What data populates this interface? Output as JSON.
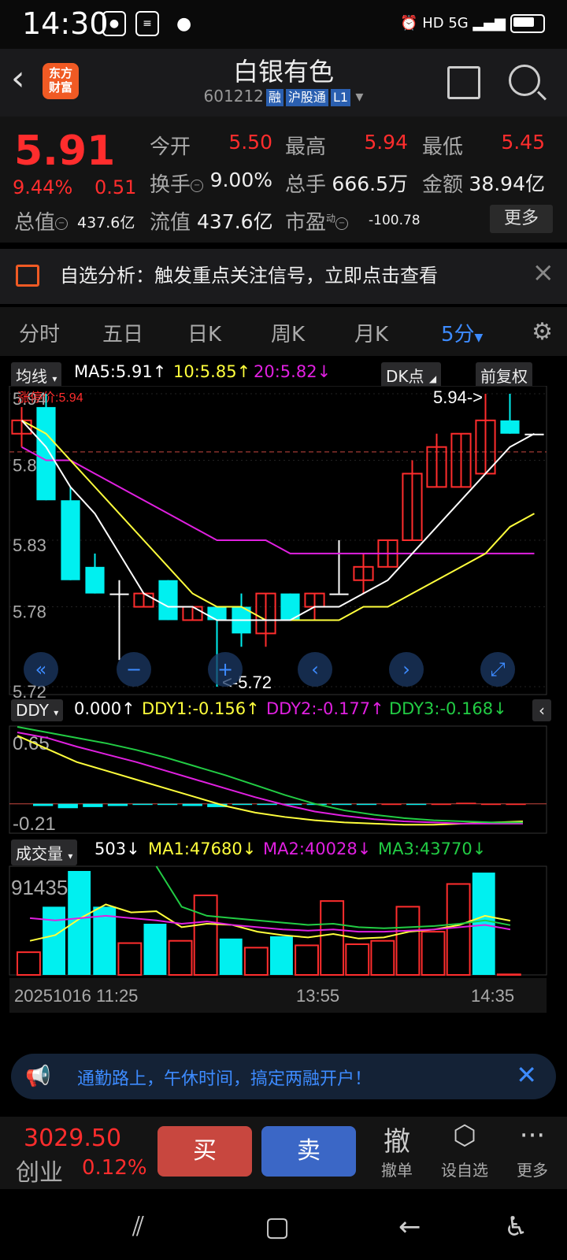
{
  "status_bar": {
    "time": "14:30",
    "right": "HD 5G"
  },
  "header": {
    "stock_name": "白银有色",
    "code": "601212",
    "tags": [
      "融",
      "沪股通",
      "L1"
    ],
    "logo_line1": "东方",
    "logo_line2": "财富"
  },
  "quote": {
    "price": "5.91",
    "pct": "9.44%",
    "change": "0.51",
    "open_label": "今开",
    "open": "5.50",
    "high_label": "最高",
    "high": "5.94",
    "low_label": "最低",
    "low": "5.45",
    "turnover_label": "换手",
    "turnover": "9.00%",
    "volume_label": "总手",
    "volume": "666.5万",
    "amount_label": "金额",
    "amount": "38.94亿",
    "mktcap_label": "总值",
    "mktcap": "437.6亿",
    "float_label": "流值",
    "float": "437.6亿",
    "pe_label": "市盈",
    "pe_sup": "动",
    "pe": "-100.78",
    "more": "更多"
  },
  "banner": {
    "text": "自选分析：触发重点关注信号，立即点击查看"
  },
  "tabs": [
    "分时",
    "五日",
    "日K",
    "周K",
    "月K",
    "5分"
  ],
  "ma_legend": {
    "chip": "均线",
    "ma5": "MA5:5.91",
    "ma10": "10:5.85",
    "ma20": "20:5.82",
    "dk": "DK点",
    "adj": "前复权"
  },
  "colors": {
    "up": "#ff2d2d",
    "down": "#00f0f0",
    "ma5": "#ffffff",
    "ma10": "#ffff3c",
    "ma20": "#e020e0",
    "green": "#22cc44",
    "accent": "#3d8bff"
  },
  "chart_data": [
    {
      "type": "candlestick",
      "title": "",
      "ylim": [
        5.72,
        5.94
      ],
      "y_ticks": [
        "5.94",
        "5.89",
        "5.83",
        "5.78",
        "5.72"
      ],
      "limit_label": "涨停价:5.94",
      "high_marker": "5.94->",
      "low_marker": "<-5.72",
      "candles": [
        {
          "o": 5.91,
          "c": 5.92,
          "h": 5.93,
          "l": 5.9
        },
        {
          "o": 5.93,
          "c": 5.86,
          "h": 5.94,
          "l": 5.86
        },
        {
          "o": 5.86,
          "c": 5.8,
          "h": 5.87,
          "l": 5.8
        },
        {
          "o": 5.81,
          "c": 5.79,
          "h": 5.82,
          "l": 5.79
        },
        {
          "o": 5.79,
          "c": 5.79,
          "h": 5.8,
          "l": 5.74
        },
        {
          "o": 5.78,
          "c": 5.79,
          "h": 5.79,
          "l": 5.78
        },
        {
          "o": 5.8,
          "c": 5.77,
          "h": 5.8,
          "l": 5.77
        },
        {
          "o": 5.77,
          "c": 5.78,
          "h": 5.78,
          "l": 5.77
        },
        {
          "o": 5.78,
          "c": 5.77,
          "h": 5.78,
          "l": 5.72
        },
        {
          "o": 5.78,
          "c": 5.76,
          "h": 5.79,
          "l": 5.75
        },
        {
          "o": 5.76,
          "c": 5.79,
          "h": 5.79,
          "l": 5.75
        },
        {
          "o": 5.79,
          "c": 5.77,
          "h": 5.79,
          "l": 5.77
        },
        {
          "o": 5.78,
          "c": 5.79,
          "h": 5.79,
          "l": 5.77
        },
        {
          "o": 5.79,
          "c": 5.79,
          "h": 5.83,
          "l": 5.79
        },
        {
          "o": 5.8,
          "c": 5.81,
          "h": 5.82,
          "l": 5.79
        },
        {
          "o": 5.81,
          "c": 5.83,
          "h": 5.83,
          "l": 5.81
        },
        {
          "o": 5.83,
          "c": 5.88,
          "h": 5.89,
          "l": 5.83
        },
        {
          "o": 5.87,
          "c": 5.9,
          "h": 5.91,
          "l": 5.87
        },
        {
          "o": 5.87,
          "c": 5.91,
          "h": 5.91,
          "l": 5.87
        },
        {
          "o": 5.88,
          "c": 5.92,
          "h": 5.94,
          "l": 5.88
        },
        {
          "o": 5.92,
          "c": 5.91,
          "h": 5.94,
          "l": 5.91
        },
        {
          "o": 5.91,
          "c": 5.91,
          "h": 5.91,
          "l": 5.91
        }
      ],
      "ma5": [
        5.92,
        5.9,
        5.87,
        5.85,
        5.82,
        5.79,
        5.78,
        5.78,
        5.77,
        5.77,
        5.77,
        5.77,
        5.78,
        5.78,
        5.79,
        5.8,
        5.82,
        5.84,
        5.86,
        5.88,
        5.9,
        5.91
      ],
      "ma10": [
        5.92,
        5.91,
        5.89,
        5.87,
        5.85,
        5.83,
        5.81,
        5.79,
        5.78,
        5.78,
        5.77,
        5.77,
        5.77,
        5.77,
        5.78,
        5.78,
        5.79,
        5.8,
        5.81,
        5.82,
        5.84,
        5.85
      ],
      "ma20": [
        5.9,
        5.89,
        5.89,
        5.88,
        5.87,
        5.86,
        5.85,
        5.84,
        5.83,
        5.83,
        5.83,
        5.82,
        5.82,
        5.82,
        5.82,
        5.82,
        5.82,
        5.82,
        5.82,
        5.82,
        5.82,
        5.82
      ]
    },
    {
      "type": "line",
      "title": "DDY",
      "ylim": [
        -0.21,
        0.65
      ],
      "y_ticks": [
        "0.65",
        "-0.21"
      ],
      "series": [
        {
          "name": "DDY1:-0.156",
          "values": [
            0.62,
            0.5,
            0.38,
            0.3,
            0.22,
            0.14,
            0.06,
            -0.02,
            -0.08,
            -0.12,
            -0.15,
            -0.17,
            -0.18,
            -0.19,
            -0.19,
            -0.18,
            -0.17,
            -0.16
          ]
        },
        {
          "name": "DDY2:-0.177",
          "values": [
            0.65,
            0.6,
            0.52,
            0.45,
            0.38,
            0.3,
            0.22,
            0.14,
            0.06,
            -0.01,
            -0.07,
            -0.11,
            -0.14,
            -0.16,
            -0.17,
            -0.18,
            -0.18,
            -0.18
          ]
        },
        {
          "name": "DDY3:-0.168",
          "values": [
            0.7,
            0.65,
            0.6,
            0.55,
            0.49,
            0.42,
            0.34,
            0.26,
            0.17,
            0.08,
            0.0,
            -0.06,
            -0.1,
            -0.13,
            -0.15,
            -0.16,
            -0.17,
            -0.17
          ]
        }
      ],
      "value_label": "0.000",
      "bars": [
        -0.02,
        -0.04,
        -0.03,
        -0.02,
        -0.01,
        -0.01,
        -0.02,
        -0.03,
        -0.01,
        -0.01,
        -0.01,
        -0.01,
        -0.01,
        -0.01,
        0.0,
        -0.01,
        0.0,
        0.01,
        0.0,
        0.0
      ]
    },
    {
      "type": "bar",
      "title": "成交量",
      "y_ticks": [
        "91435"
      ],
      "value_label": "503",
      "series": [
        {
          "name": "MA1:47680"
        },
        {
          "name": "MA2:40028"
        },
        {
          "name": "MA3:43770"
        }
      ],
      "values": [
        20000,
        60000,
        91435,
        60000,
        28000,
        45000,
        30000,
        70000,
        32000,
        24000,
        34000,
        26000,
        65000,
        27000,
        30000,
        60000,
        38000,
        80000,
        90000,
        500
      ],
      "colors_up": [
        true,
        false,
        false,
        false,
        true,
        false,
        true,
        true,
        false,
        true,
        false,
        true,
        true,
        true,
        true,
        true,
        true,
        true,
        false,
        true
      ],
      "x_labels": [
        "20251016 11:25",
        "13:55",
        "14:35"
      ]
    }
  ],
  "ddy_legend": {
    "chip": "DDY",
    "v": "0.000",
    "d1": "DDY1:-0.156",
    "d2": "DDY2:-0.177",
    "d3": "DDY3:-0.168"
  },
  "vol_legend": {
    "chip": "成交量",
    "v": "503",
    "m1": "MA1:47680",
    "m2": "MA2:40028",
    "m3": "MA3:43770"
  },
  "ad": {
    "text": "通勤路上，午休时间，搞定两融开户！"
  },
  "toolbar": {
    "index_value": "3029.50",
    "index_name": "创业",
    "index_pct": "0.12%",
    "buy": "买",
    "sell": "卖",
    "cancel_icon": "撤",
    "cancel": "撤单",
    "fav": "设自选",
    "more": "更多"
  }
}
